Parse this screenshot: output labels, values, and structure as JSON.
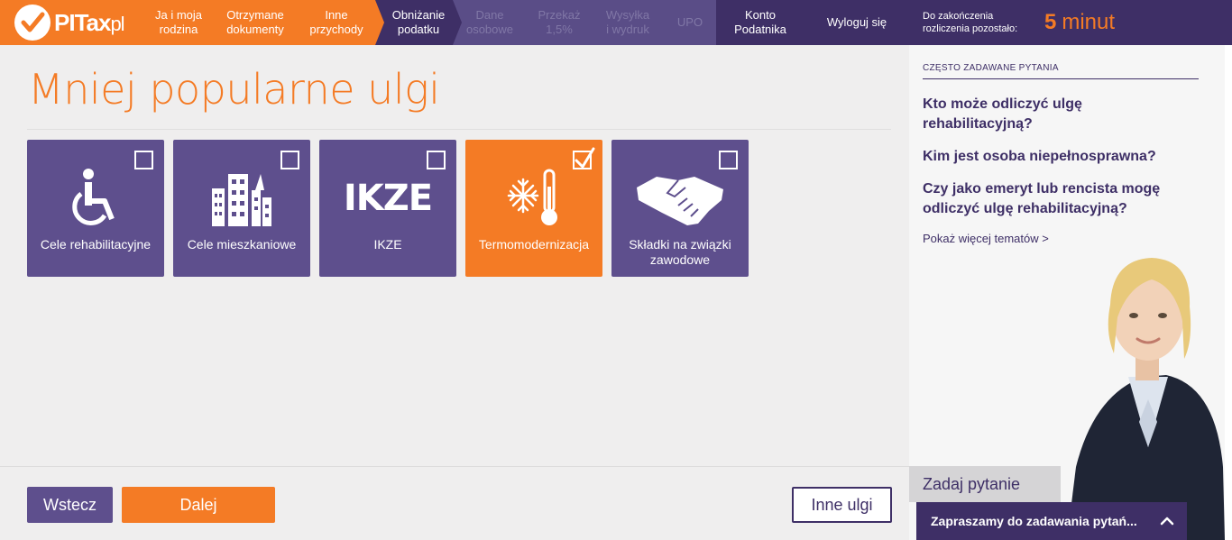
{
  "header": {
    "logo": {
      "main": "PITax",
      "suffix": "pl"
    },
    "steps": [
      {
        "line1": "Ja i moja",
        "line2": "rodzina",
        "state": "done"
      },
      {
        "line1": "Otrzymane",
        "line2": "dokumenty",
        "state": "done"
      },
      {
        "line1": "Inne",
        "line2": "przychody",
        "state": "done"
      },
      {
        "line1": "Obniżanie",
        "line2": "podatku",
        "state": "active"
      },
      {
        "line1": "Dane",
        "line2": "osobowe",
        "state": "future"
      },
      {
        "line1": "Przekaż",
        "line2": "1,5%",
        "state": "future"
      },
      {
        "line1": "Wysyłka",
        "line2": "i wydruk",
        "state": "future"
      },
      {
        "line1": "UPO",
        "line2": "",
        "state": "future"
      }
    ],
    "account": {
      "line1": "Konto",
      "line2": "Podatnika"
    },
    "logout": "Wyloguj się",
    "timer": {
      "label_line1": "Do zakończenia",
      "label_line2": "rozliczenia pozostało:",
      "value": "5",
      "unit": "minut"
    }
  },
  "main": {
    "title": "Mniej popularne ulgi",
    "tiles": [
      {
        "label": "Cele rehabilitacyjne",
        "icon": "wheelchair-icon",
        "checked": false
      },
      {
        "label": "Cele mieszkaniowe",
        "icon": "buildings-icon",
        "checked": false
      },
      {
        "label": "IKZE",
        "icon": "ikze-text-icon",
        "icon_text": "IKZE",
        "checked": false
      },
      {
        "label": "Termomodernizacja",
        "icon": "snowflake-thermometer-icon",
        "checked": true
      },
      {
        "label": "Składki na związki zawodowe",
        "icon": "handshake-icon",
        "checked": false
      }
    ]
  },
  "footer": {
    "back": "Wstecz",
    "next": "Dalej",
    "other": "Inne ulgi"
  },
  "sidebar": {
    "faq_heading": "CZĘSTO ZADAWANE PYTANIA",
    "faq": [
      "Kto może odliczyć ulgę rehabilitacyjną?",
      "Kim jest osoba niepełnosprawna?",
      "Czy jako emeryt lub rencista mogę odliczyć ulgę rehabilitacyjną?"
    ],
    "more": "Pokaż więcej tematów >",
    "ask": "Zadaj pytanie",
    "chat": "Zapraszamy do zadawania pytań..."
  },
  "colors": {
    "orange": "#f47b25",
    "purple": "#5e4f8d",
    "dark_purple": "#3e2f66",
    "background": "#efeeee"
  }
}
